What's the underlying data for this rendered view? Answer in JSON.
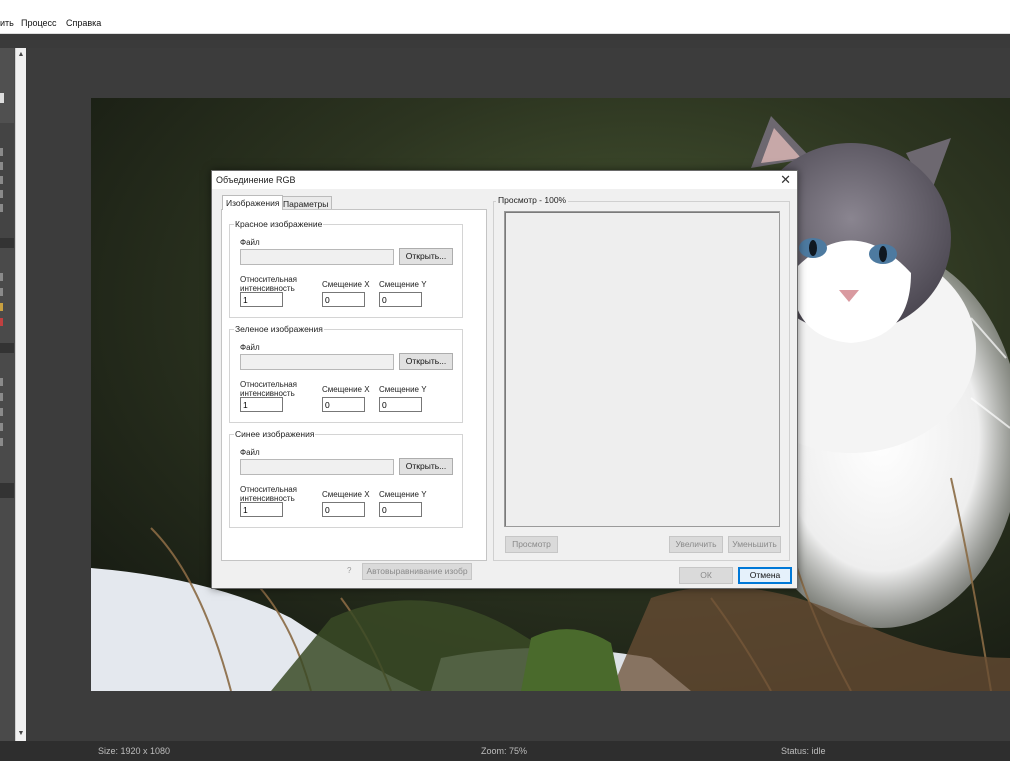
{
  "menubar": {
    "items": [
      "ить",
      "Процесс",
      "Справка"
    ]
  },
  "statusbar": {
    "size": "Size: 1920 x 1080",
    "zoom": "Zoom: 75%",
    "status": "Status: idle"
  },
  "dialog": {
    "title": "Объединение RGB",
    "tabs": [
      "Изображения",
      "Параметры"
    ],
    "groups": [
      {
        "title": "Красное изображение",
        "file_label": "Файл",
        "open_label": "Открыть...",
        "intensity_label": "Относительная интенсивность",
        "intensity": "1",
        "shiftx_label": "Смещение X",
        "shiftx": "0",
        "shifty_label": "Смещение Y",
        "shifty": "0"
      },
      {
        "title": "Зеленое изображения",
        "file_label": "Файл",
        "open_label": "Открыть...",
        "intensity_label": "Относительная интенсивность",
        "intensity": "1",
        "shiftx_label": "Смещение X",
        "shiftx": "0",
        "shifty_label": "Смещение Y",
        "shifty": "0"
      },
      {
        "title": "Синее изображения",
        "file_label": "Файл",
        "open_label": "Открыть...",
        "intensity_label": "Относительная интенсивность",
        "intensity": "1",
        "shiftx_label": "Смещение X",
        "shiftx": "0",
        "shifty_label": "Смещение Y",
        "shifty": "0"
      }
    ],
    "auto_align_label": "Автовыравнивание изобр",
    "preview": {
      "title": "Просмотр - 100%",
      "preview_btn": "Просмотр",
      "zoom_in": "Увеличить",
      "zoom_out": "Уменьшить"
    },
    "ok_label": "ОК",
    "cancel_label": "Отмена"
  },
  "colors": {
    "accent": "#0078d7"
  }
}
